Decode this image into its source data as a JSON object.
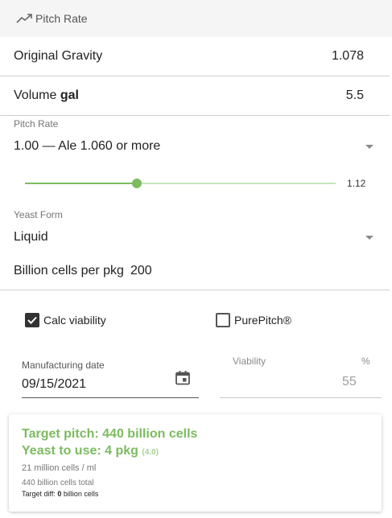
{
  "header": {
    "icon": "trending-up-icon",
    "title": "Pitch Rate"
  },
  "original_gravity": {
    "label": "Original Gravity",
    "value": "1.078"
  },
  "volume": {
    "label": "Volume",
    "unit": "gal",
    "value": "5.5"
  },
  "pitch_rate": {
    "label": "Pitch Rate",
    "selected": "1.00 — Ale 1.060 or more",
    "slider_value": "1.12",
    "slider_fraction": 0.36
  },
  "yeast_form": {
    "label": "Yeast Form",
    "selected": "Liquid"
  },
  "billion_cells": {
    "label": "Billion cells per pkg",
    "value": "200"
  },
  "checkboxes": {
    "calc_viability": {
      "label": "Calc viability",
      "checked": true
    },
    "purepitch": {
      "label": "PurePitch®",
      "checked": false
    }
  },
  "manufacturing_date": {
    "label": "Manufacturing date",
    "value": "09/15/2021",
    "icon": "calendar-icon"
  },
  "viability": {
    "label": "Viability",
    "unit": "%",
    "value": "55"
  },
  "result": {
    "target_pitch": "Target pitch: 440 billion cells",
    "yeast_to_use": "Yeast to use: 4 pkg",
    "yeast_exact": "(4.0)",
    "cells_per_ml": "21 million cells / ml",
    "total": "440 billion cells total",
    "target_diff_prefix": "Target diff:",
    "target_diff_value": "0",
    "target_diff_suffix": "billion cells"
  },
  "colors": {
    "accent": "#7cbb5f",
    "accent_light": "#c9e3bd",
    "header_bg": "#f5f5f5"
  }
}
